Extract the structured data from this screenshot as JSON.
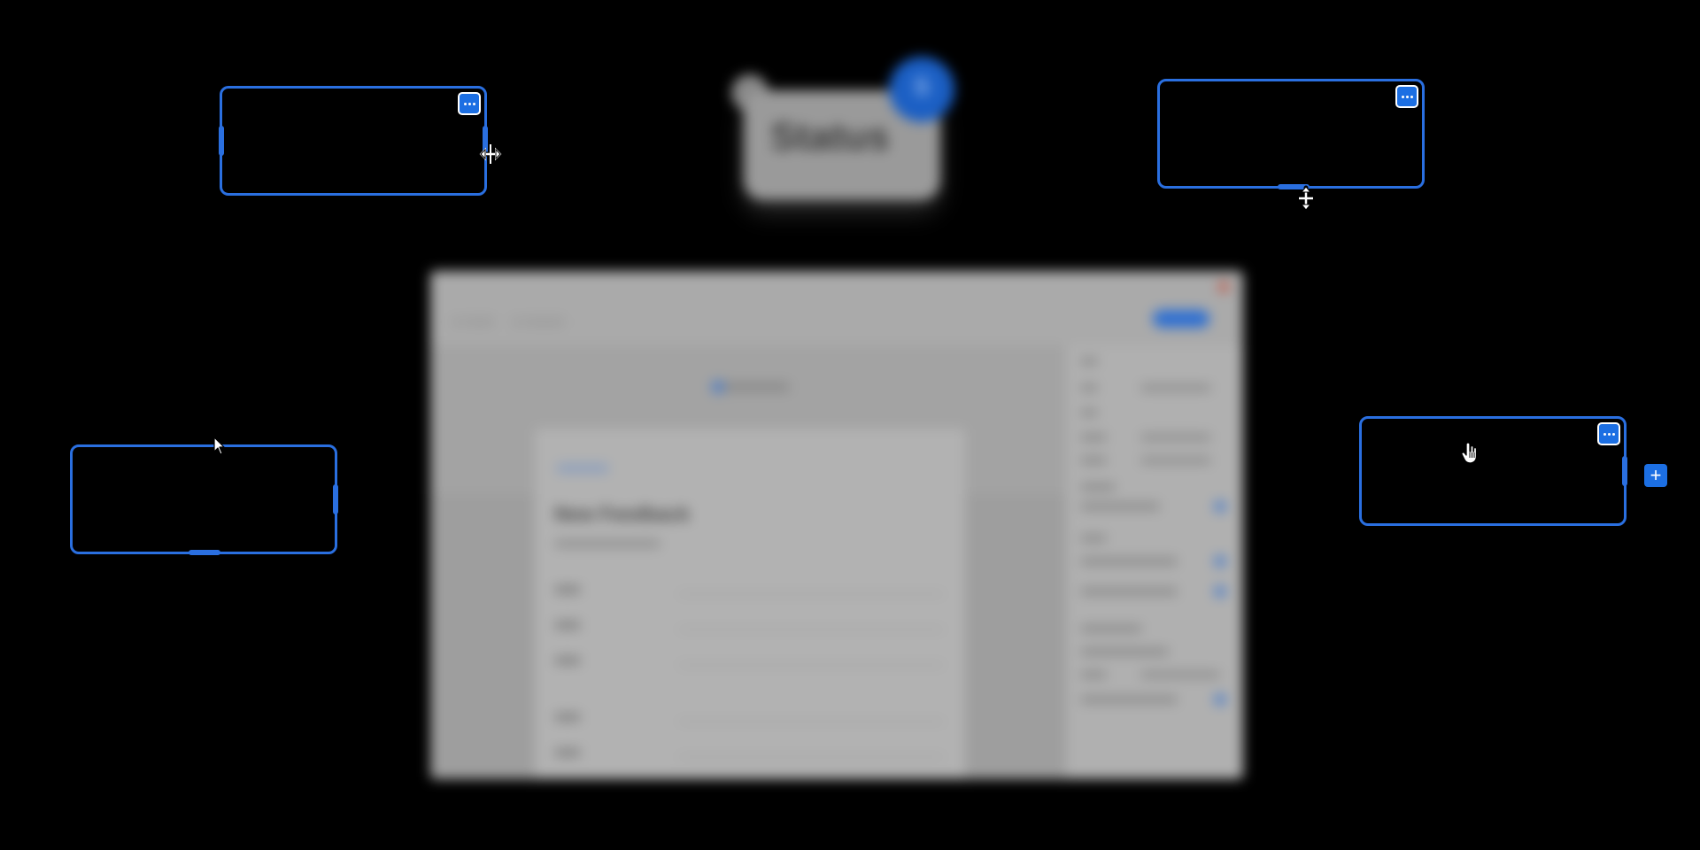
{
  "status_widget": {
    "label": "Status",
    "badge_initial": "S"
  },
  "app_preview": {
    "form_title": "New Feedback"
  },
  "frames": [
    {
      "id": "top-left",
      "menu_label": "More options"
    },
    {
      "id": "top-right",
      "menu_label": "More options"
    },
    {
      "id": "mid-left",
      "menu_label": ""
    },
    {
      "id": "mid-right",
      "menu_label": "More options"
    }
  ],
  "add_button": {
    "symbol": "+"
  },
  "icons": {
    "menu": "more-horizontal-icon",
    "add": "plus-icon",
    "cursor_horizontal": "resize-horizontal-cursor-icon",
    "cursor_vertical": "resize-vertical-cursor-icon",
    "cursor_pointer": "arrow-cursor-icon",
    "cursor_hand": "hand-cursor-icon"
  },
  "colors": {
    "background": "#000000",
    "accent": "#1c6fe3",
    "frame_border": "#2a6fe0"
  }
}
